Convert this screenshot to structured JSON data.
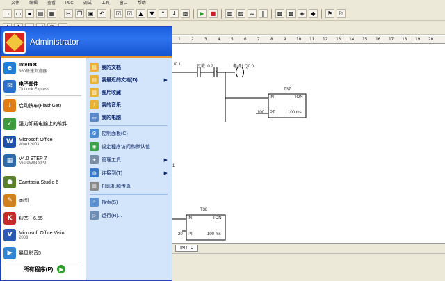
{
  "app": {
    "menus": [
      "文件",
      "编辑",
      "查看",
      "PLC",
      "调试",
      "工具",
      "窗口",
      "帮助"
    ],
    "toolbar1_icons": [
      "new-icon",
      "open-icon",
      "save-icon",
      "print-icon",
      "print-preview-icon",
      "cut-icon",
      "copy-icon",
      "paste-icon",
      "undo-icon",
      "compile-icon",
      "compile-all-icon",
      "upload-icon",
      "download-icon",
      "sort-asc-icon",
      "sort-desc-icon",
      "options-icon",
      "run-icon",
      "stop-icon",
      "monitor-icon",
      "status-icon",
      "trend-icon",
      "pause-icon",
      "force-icon",
      "unforce-icon",
      "read-icon",
      "write-icon",
      "bookmark-icon",
      "bookmark-next-icon"
    ],
    "ruler": [
      "1",
      "2",
      "3",
      "4",
      "5",
      "6",
      "7",
      "8",
      "9",
      "10",
      "11",
      "12",
      "13",
      "14",
      "15",
      "16",
      "17",
      "18",
      "19",
      "20"
    ],
    "ladder": {
      "c1": "I0.1",
      "c2": "过载:I0.2",
      "coil": "电机1:Q0.0",
      "c2_mark": "/",
      "t37": "T37",
      "t37_in": "IN",
      "t37_ton": "TON",
      "t37_pt_val": "100",
      "t37_pt": "PT",
      "t37_ms": "100 ms",
      "t38": "T38",
      "t38_in": "IN",
      "t38_ton": "TON",
      "t38_pt_val": "20",
      "t38_pt": "PT",
      "t38_ms": "100 ms",
      "side_mark": "1"
    },
    "tab": "INT_0"
  },
  "startmenu": {
    "user": "Administrator",
    "left_items": [
      {
        "t1": "Internet",
        "t2": "360极速浏览器",
        "icon": "browser-icon",
        "color": "#1f7fd6"
      },
      {
        "t1": "电子邮件",
        "t2": "Outlook Express",
        "icon": "outlook-icon",
        "color": "#2a6fc9"
      },
      {
        "t1": "启动快车(FlashGet)",
        "t2": "",
        "icon": "flashget-icon",
        "color": "#e07c12"
      },
      {
        "t1": "强力卸载电脑上的软件",
        "t2": "",
        "icon": "uninstall-icon",
        "color": "#3d9a3d"
      },
      {
        "t1": "Microsoft Office",
        "t2": "Word 2003",
        "icon": "word-icon",
        "color": "#1c4fa8"
      },
      {
        "t1": "V4.0 STEP 7",
        "t2": "MicroWIN SP9",
        "icon": "step7-icon",
        "color": "#2f6aa8"
      },
      {
        "t1": "Camtasia Studio 6",
        "t2": "",
        "icon": "camtasia-icon",
        "color": "#5a7f2a"
      },
      {
        "t1": "画图",
        "t2": "",
        "icon": "paint-icon",
        "color": "#d0801c"
      },
      {
        "t1": "钮杰王6.55",
        "t2": "",
        "icon": "kingsoft-icon",
        "color": "#c62b2b"
      },
      {
        "t1": "Microsoft Office Visio",
        "t2": "2003",
        "icon": "visio-icon",
        "color": "#2a5ab3"
      },
      {
        "t1": "暴风影音5",
        "t2": "",
        "icon": "baofeng-icon",
        "color": "#2f86d6"
      }
    ],
    "all_programs": "所有程序(P)",
    "right_items": [
      {
        "label": "我的文档",
        "icon": "my-documents-icon",
        "color": "#e8b23a",
        "bold": true,
        "chev": false
      },
      {
        "label": "我最近的文档(D)",
        "icon": "recent-documents-icon",
        "color": "#e8b23a",
        "bold": true,
        "chev": true
      },
      {
        "label": "图片收藏",
        "icon": "my-pictures-icon",
        "color": "#e8b23a",
        "bold": true,
        "chev": false
      },
      {
        "label": "我的音乐",
        "icon": "my-music-icon",
        "color": "#e8b23a",
        "bold": true,
        "chev": false
      },
      {
        "label": "我的电脑",
        "icon": "my-computer-icon",
        "color": "#5b87c9",
        "bold": true,
        "chev": false
      },
      {
        "label": "控制面板(C)",
        "icon": "control-panel-icon",
        "color": "#4a8bd0",
        "bold": false,
        "chev": false
      },
      {
        "label": "设定程序访问和默认值",
        "icon": "default-programs-icon",
        "color": "#3aa04a",
        "bold": false,
        "chev": false
      },
      {
        "label": "管理工具",
        "icon": "admin-tools-icon",
        "color": "#7a8fa6",
        "bold": false,
        "chev": true
      },
      {
        "label": "连接到(T)",
        "icon": "connect-icon",
        "color": "#3a78c8",
        "bold": false,
        "chev": true
      },
      {
        "label": "打印机和传真",
        "icon": "printer-icon",
        "color": "#8a8a8a",
        "bold": false,
        "chev": false
      },
      {
        "label": "搜索(S)",
        "icon": "search-icon",
        "color": "#5a8fd0",
        "bold": false,
        "chev": false
      },
      {
        "label": "运行(R)...",
        "icon": "run-dialog-icon",
        "color": "#6d8db3",
        "bold": false,
        "chev": false
      }
    ]
  }
}
